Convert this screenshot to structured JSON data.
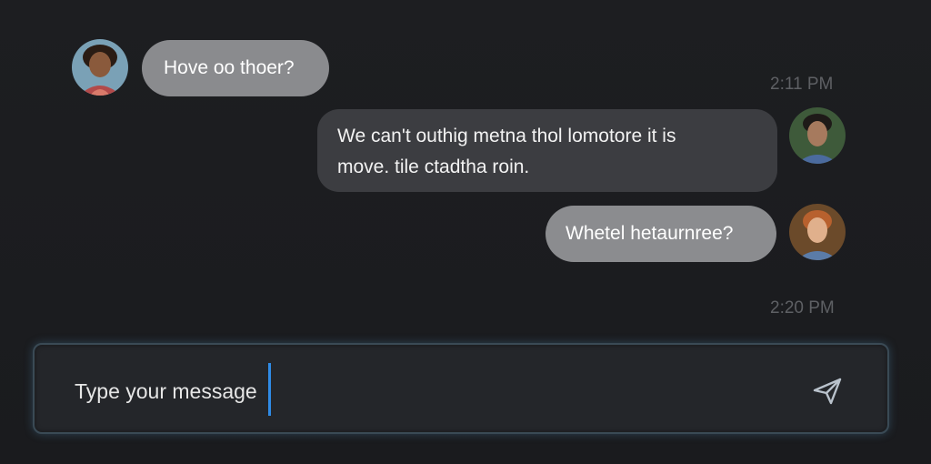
{
  "messages": [
    {
      "text": "Hove oo thoer?",
      "side": "incoming"
    },
    {
      "line1": "We can't outhig metna thol lomotore it is",
      "line2": "move. tile ctadtha roin.",
      "side": "outgoing"
    },
    {
      "text": "Whetel hetaurnree?",
      "side": "outgoing"
    }
  ],
  "timestamps": [
    "2:11 PM",
    "2:20 PM"
  ],
  "composer": {
    "placeholder": "Type your message",
    "send_icon": "send-icon"
  },
  "colors": {
    "background": "#1b1c1f",
    "incoming_bubble": "#8a8b8e",
    "outgoing_bubble": "#3c3d41",
    "caret": "#2f8be6"
  }
}
